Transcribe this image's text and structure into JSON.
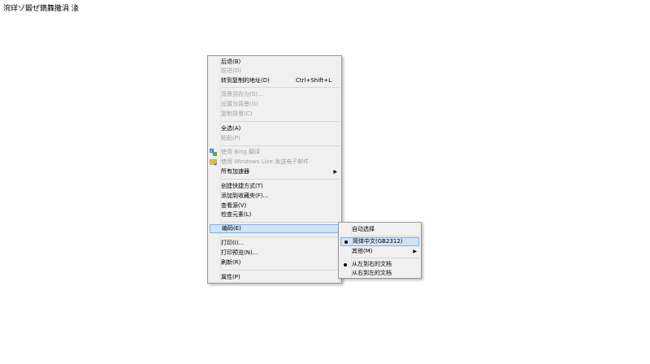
{
  "page": {
    "text": "涴珜ゾ鍛ぜ鐫橆撒涓   湪"
  },
  "context_menu": {
    "back": "后退(B)",
    "forward": "前进(O)",
    "goto_copied": "转到复制的地址(D)",
    "goto_copied_shortcut": "Ctrl+Shift+L",
    "save_background": "背景另存为(S)...",
    "set_background": "设置为背景(G)",
    "copy_background": "复制背景(C)",
    "select_all": "全选(A)",
    "paste": "粘贴(P)",
    "bing_translate": "使用 Bing 翻译",
    "windows_live_mail": "使用 Windows Live 发送电子邮件",
    "all_accelerators": "所有加速器",
    "create_shortcut": "创建快捷方式(T)",
    "add_favorites": "添加到收藏夹(F)...",
    "view_source": "查看源(V)",
    "inspect_element": "检查元素(L)",
    "encoding": "编码(E)",
    "print": "打印(I)...",
    "print_preview": "打印预览(N)...",
    "refresh": "刷新(R)",
    "properties": "属性(P)"
  },
  "encoding_submenu": {
    "auto_select": "自动选择",
    "gb2312": "简体中文(GB2312)",
    "other": "其他(M)",
    "ltr": "从左到右的文档",
    "rtl": "从右到左的文档"
  },
  "colors": {
    "menu_bg": "#f0f0f0",
    "highlight_bg": "#d1e3f7",
    "highlight_border": "#7fb1e6",
    "disabled_text": "#a0a0a0"
  }
}
